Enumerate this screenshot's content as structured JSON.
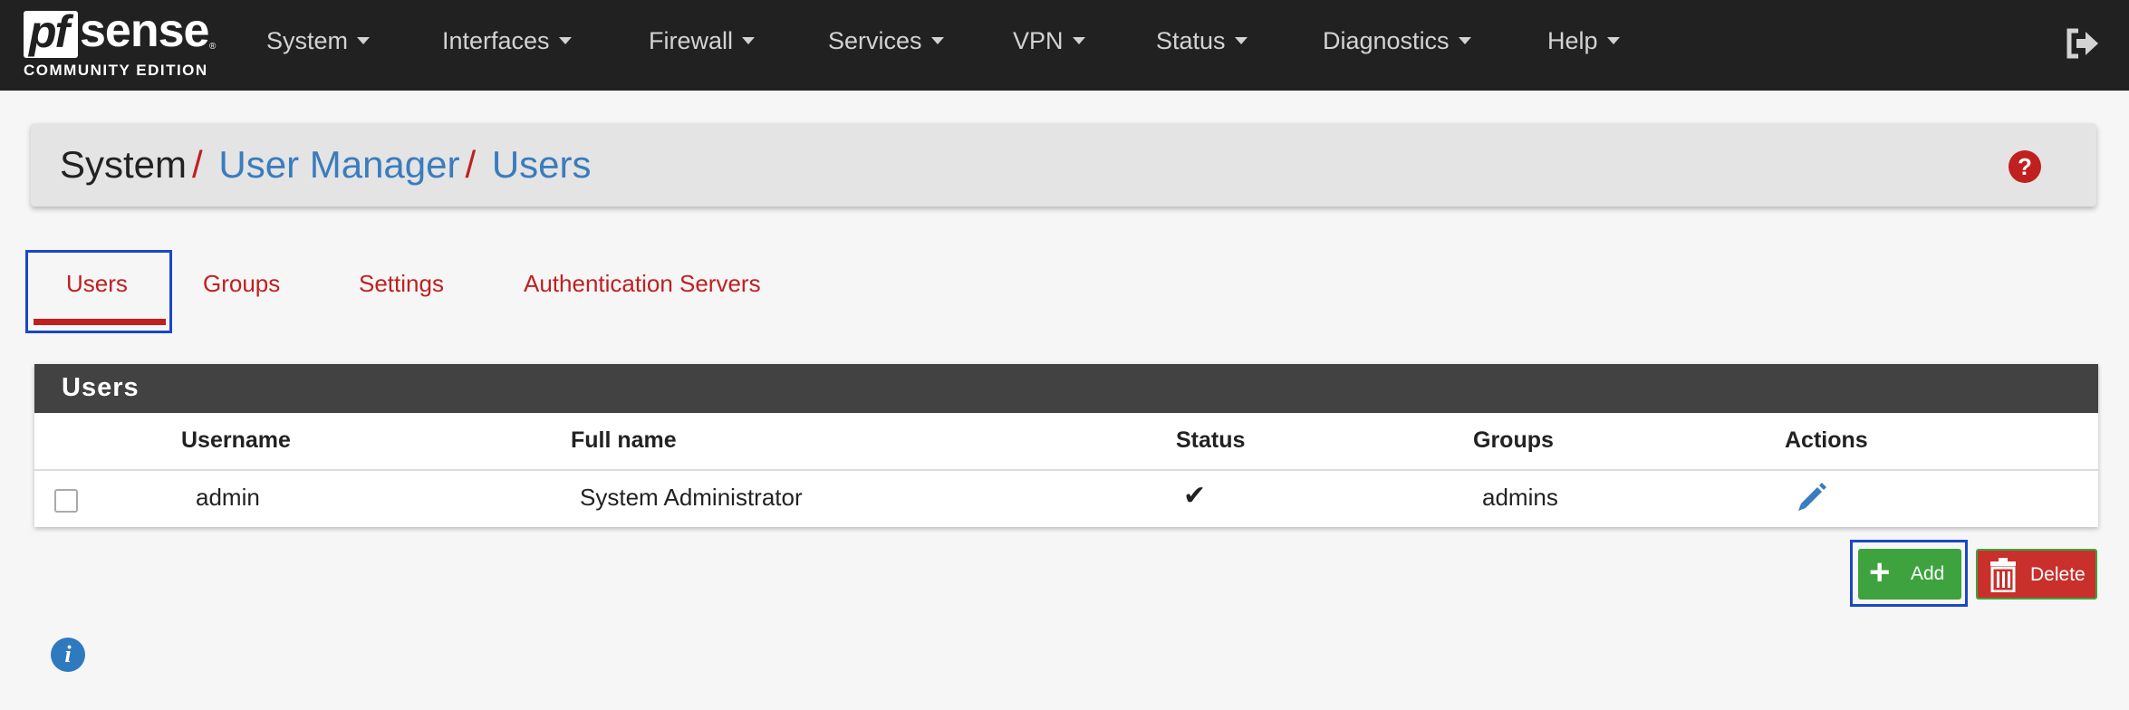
{
  "brand": {
    "logo_pf": "pf",
    "logo_sense": "sense",
    "logo_tm": "®",
    "logo_sub": "COMMUNITY EDITION"
  },
  "nav": {
    "items": [
      {
        "label": "System"
      },
      {
        "label": "Interfaces"
      },
      {
        "label": "Firewall"
      },
      {
        "label": "Services"
      },
      {
        "label": "VPN"
      },
      {
        "label": "Status"
      },
      {
        "label": "Diagnostics"
      },
      {
        "label": "Help"
      }
    ],
    "logout_icon": "sign-out-icon"
  },
  "breadcrumb": {
    "root": "System",
    "separator": "/",
    "level2": "User Manager",
    "level3": "Users",
    "help_icon": "question-circle-icon",
    "help_glyph": "?"
  },
  "tabs": [
    {
      "label": "Users",
      "active": true
    },
    {
      "label": "Groups"
    },
    {
      "label": "Settings"
    },
    {
      "label": "Authentication Servers"
    }
  ],
  "users_panel": {
    "title": "Users",
    "columns": [
      "Username",
      "Full name",
      "Status",
      "Groups",
      "Actions"
    ],
    "rows": [
      {
        "username": "admin",
        "full_name": "System Administrator",
        "status_icon": "check-icon",
        "status_glyph": "✔",
        "groups": "admins",
        "action_icon": "pencil-icon"
      }
    ]
  },
  "buttons": {
    "add_label": "Add",
    "add_glyph": "+",
    "delete_label": "Delete"
  },
  "info_icon": "info-circle-icon",
  "info_glyph": "i",
  "colors": {
    "navbar": "#212121",
    "accent_red": "#c02020",
    "link_blue": "#3a7cbd",
    "success_green": "#3ea33e",
    "danger_red": "#c9302c"
  }
}
